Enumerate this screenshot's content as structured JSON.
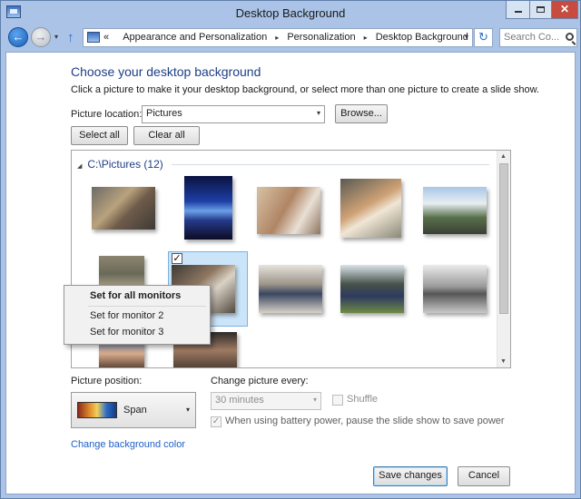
{
  "window": {
    "title": "Desktop Background",
    "controls": {
      "minimize": "",
      "maximize": "",
      "close": "✕"
    }
  },
  "navigation": {
    "back_glyph": "←",
    "forward_glyph": "→",
    "dropdown_glyph": "▾",
    "up_glyph": "↑",
    "address_prefix": "«",
    "breadcrumbs": [
      "Appearance and Personalization",
      "Personalization",
      "Desktop Background"
    ],
    "breadcrumb_separator": "▸",
    "address_chevron": "▾",
    "refresh_glyph": "↻",
    "search_placeholder": "Search Co..."
  },
  "content": {
    "heading": "Choose your desktop background",
    "instructions": "Click a picture to make it your desktop background, or select more than one picture to create a slide show.",
    "picture_location_label": "Picture location:",
    "picture_location_value": "Pictures",
    "browse_label": "Browse...",
    "select_all_label": "Select all",
    "clear_all_label": "Clear all",
    "gallery": {
      "group_title": "C:\\Pictures (12)",
      "checkmark": "✓"
    },
    "context_menu": {
      "items": [
        "Set for all monitors",
        "Set for monitor 2",
        "Set for monitor 3"
      ]
    },
    "picture_position_label": "Picture position:",
    "picture_position_value": "Span",
    "change_picture_label": "Change picture every:",
    "interval_value": "30 minutes",
    "shuffle_label": "Shuffle",
    "battery_label": "When using battery power, pause the slide show to save power",
    "battery_checkmark": "✓",
    "change_color_link": "Change background color",
    "save_label": "Save changes",
    "cancel_label": "Cancel"
  },
  "colors": {
    "heading_blue": "#1e3f86",
    "link_blue": "#1e5fc8",
    "selection_fill": "#cbe4f8",
    "close_button": "#c74b3f"
  }
}
